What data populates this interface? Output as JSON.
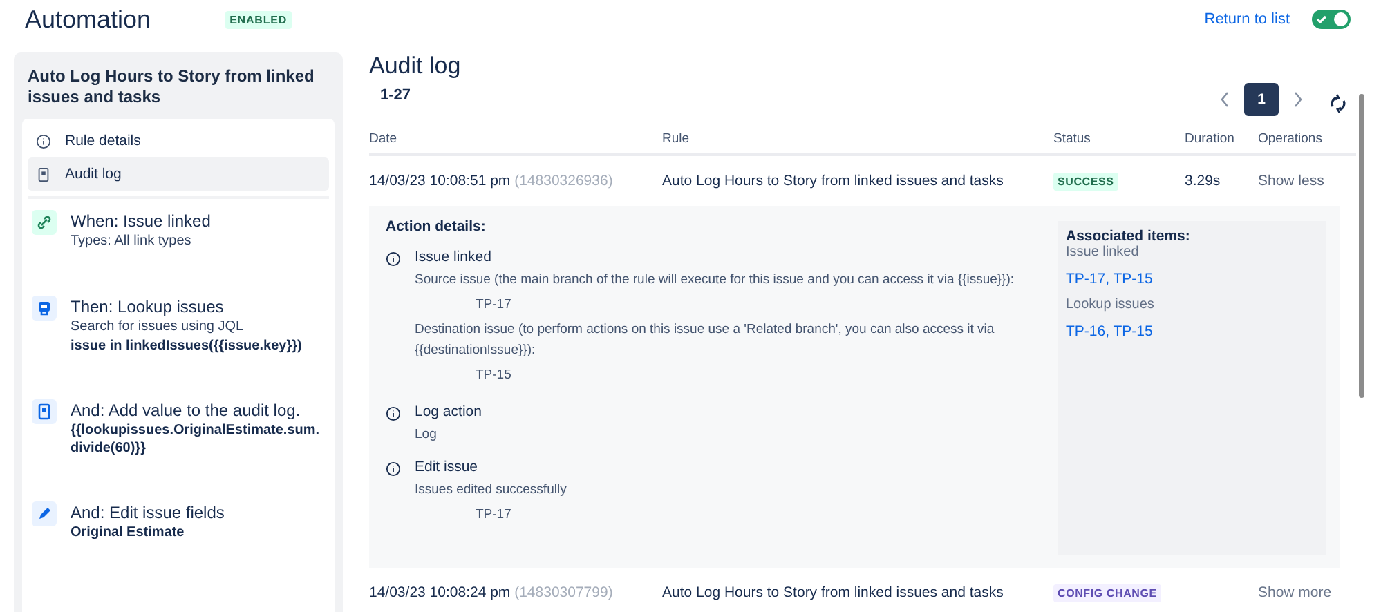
{
  "header": {
    "title": "Automation",
    "status_badge": "ENABLED",
    "return_link": "Return to list",
    "toggle_on": true
  },
  "sidebar": {
    "rule_name": "Auto Log Hours to Story from linked issues and tasks",
    "menu": [
      {
        "label": "Rule details",
        "kind": "info",
        "selected": false
      },
      {
        "label": "Audit log",
        "kind": "log",
        "selected": true
      }
    ],
    "steps": [
      {
        "kind": "link",
        "title": "When: Issue linked",
        "lines": [
          {
            "kind": "plain",
            "text": "Types: All link types"
          }
        ]
      },
      {
        "kind": "lookup",
        "title": "Then: Lookup issues",
        "lines": [
          {
            "kind": "plain",
            "text": "Search for issues using JQL"
          },
          {
            "kind": "code",
            "text": "issue in linkedIssues({{issue.key}})"
          }
        ]
      },
      {
        "kind": "log",
        "title": "And: Add value to the audit log.",
        "lines": [
          {
            "kind": "code",
            "text": "{{lookupissues.OriginalEstimate.sum.divide(60)}}"
          }
        ]
      },
      {
        "kind": "edit",
        "title": "And: Edit issue fields",
        "lines": [
          {
            "kind": "code",
            "text": "Original Estimate"
          }
        ]
      }
    ]
  },
  "audit": {
    "title": "Audit log",
    "range": "1-27",
    "pages": [
      {
        "label": "1",
        "selected": true
      }
    ],
    "columns": [
      "Date",
      "Rule",
      "Status",
      "Duration",
      "Operations"
    ],
    "rows": [
      {
        "date": "14/03/23 10:08:51 pm",
        "id": "(14830326936)",
        "rule": "Auto Log Hours to Story from linked issues and tasks",
        "status": "SUCCESS",
        "kind": "success",
        "duration": "3.29s",
        "operation": "Show less",
        "expanded": true,
        "details": {
          "heading": "Action details:",
          "actions": [
            {
              "title": "Issue linked",
              "lines": [
                {
                  "kind": "text",
                  "text": "Source issue (the main branch of the rule will execute for this issue and you can access it via {{issue}}):"
                },
                {
                  "kind": "key",
                  "text": "TP-17"
                },
                {
                  "kind": "text",
                  "text": "Destination issue (to perform actions on this issue use a 'Related branch', you can also access it via {{destinationIssue}}):"
                },
                {
                  "kind": "key",
                  "text": "TP-15"
                }
              ]
            },
            {
              "title": "Log action",
              "lines": [
                {
                  "kind": "text",
                  "text": "Log"
                }
              ]
            },
            {
              "title": "Edit issue",
              "lines": [
                {
                  "kind": "text",
                  "text": "Issues edited successfully"
                },
                {
                  "kind": "key",
                  "text": "TP-17"
                }
              ]
            }
          ],
          "associated": {
            "heading": "Associated items:",
            "groups": [
              {
                "label": "Issue linked",
                "links": "TP-17, TP-15"
              },
              {
                "label": "Lookup issues",
                "links": "TP-16, TP-15"
              }
            ]
          }
        }
      },
      {
        "date": "14/03/23 10:08:24 pm",
        "id": "(14830307799)",
        "rule": "Auto Log Hours to Story from linked issues and tasks",
        "status": "CONFIG CHANGE",
        "kind": "config",
        "operation": "Show more",
        "expanded": false
      }
    ]
  }
}
